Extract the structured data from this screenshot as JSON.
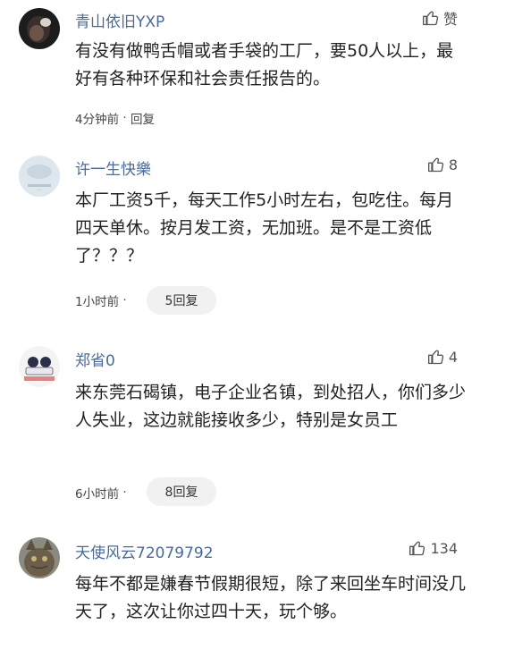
{
  "comments": [
    {
      "username": "青山依旧YXP",
      "like_label": "赞",
      "text": "有没有做鸭舌帽或者手袋的工厂，要50人以上，最好有各种环保和社会责任报告的。",
      "time": "4分钟前",
      "separator": " · ",
      "reply": "回复",
      "reply_count": ""
    },
    {
      "username": "许一生快樂",
      "like_label": "8",
      "text": "本厂工资5千，每天工作5小时左右，包吃住。每月四天单休。按月发工资，无加班。是不是工资低了？？？",
      "time": "1小时前",
      "separator": " · ",
      "reply": "",
      "reply_count": "5回复"
    },
    {
      "username": "郑省0",
      "like_label": "4",
      "text": "来东莞石碣镇，电子企业名镇，到处招人，你们多少人失业，这边就能接收多少，特别是女员工",
      "time": "6小时前",
      "separator": " · ",
      "reply": "",
      "reply_count": "8回复"
    },
    {
      "username": "天使风云72079792",
      "like_label": "134",
      "text": "每年不都是嫌春节假期很短，除了来回坐车时间没几天了，这次让你过四十天，玩个够。",
      "time": "",
      "separator": "",
      "reply": "",
      "reply_count": ""
    }
  ],
  "icons": {
    "like": "thumbs-up-icon"
  },
  "colors": {
    "username": "#4a6a9a",
    "text": "#222222",
    "meta": "#444444",
    "pill_bg": "#f1f1f1"
  }
}
